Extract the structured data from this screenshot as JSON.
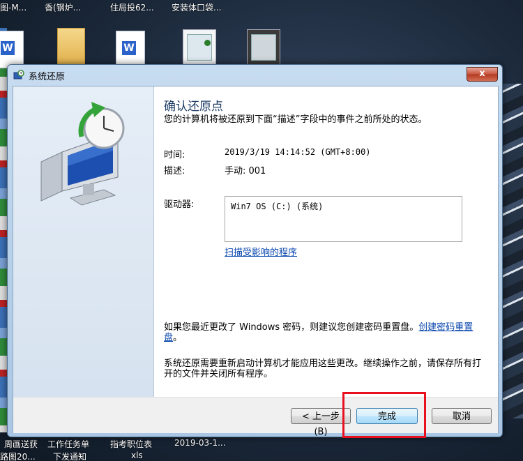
{
  "desktop": {
    "top_labels": [
      "图-M...",
      "香(钢炉...",
      "住局投62...",
      "安装体口袋..."
    ],
    "bottom_labels_row1": [
      "周画送获",
      "工作任务单",
      "指考职位表",
      "2019-03-1..."
    ],
    "bottom_labels_row2": [
      "路图20...",
      "下发通知",
      "xls"
    ],
    "doc_icon_letter": "W"
  },
  "window": {
    "title": "系统还原",
    "close_glyph": "x",
    "heading": "确认还原点",
    "description": "您的计算机将被还原到下面“描述”字段中的事件之前所处的状态。",
    "time_label": "时间:",
    "time_value": "2019/3/19 14:14:52 (GMT+8:00)",
    "desc_label": "描述:",
    "desc_value": "手动: 001",
    "drive_label": "驱动器:",
    "drive_value": "Win7 OS (C:) (系统)",
    "scan_link": "扫描受影响的程序",
    "password_text": "如果您最近更改了 Windows 密码，则建议您创建密码重置盘。",
    "password_link": "创建密码重置盘",
    "password_end": "。",
    "restart_text": "系统还原需要重新启动计算机才能应用这些更改。继续操作之前，请保存所有打开的文件并关闭所有程序。",
    "buttons": {
      "prev": "< 上一步(B)",
      "finish": "完成",
      "cancel": "取消"
    }
  },
  "colors": {
    "highlight": "#e8101f",
    "heading": "#1e3c64",
    "link": "#0645ad"
  }
}
